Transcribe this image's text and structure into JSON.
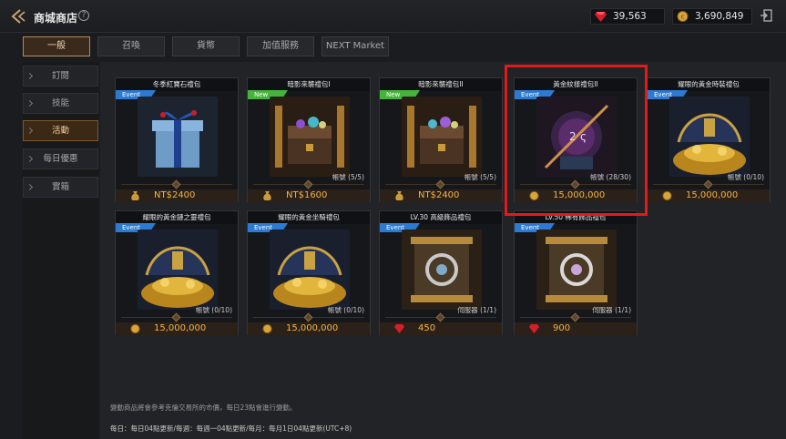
{
  "header": {
    "title": "商城商店",
    "help_glyph": "?",
    "gem_amount": "39,563",
    "coin_amount": "3,690,849"
  },
  "tabs": [
    "一般",
    "召喚",
    "貨幣",
    "加值服務",
    "NEXT Market"
  ],
  "sidebar": [
    "訂閱",
    "技能",
    "活動",
    "每日優惠",
    "實箱"
  ],
  "active_tab": "一般",
  "active_sidebar": "活動",
  "products": [
    {
      "title": "冬季紅寶石禮包",
      "badge": "Event",
      "limit": "",
      "price": "NT$2400",
      "currency_icon": "money-bag-icon",
      "art": "gift-box"
    },
    {
      "title": "暗影來襲禮包I",
      "badge": "New",
      "limit": "帳號 (5/5)",
      "price": "NT$1600",
      "currency_icon": "money-bag-icon",
      "art": "treasure-chest"
    },
    {
      "title": "暗影來襲禮包II",
      "badge": "New",
      "limit": "帳號 (5/5)",
      "price": "NT$2400",
      "currency_icon": "money-bag-icon",
      "art": "treasure-chest"
    },
    {
      "title": "黃金紋樣禮包II",
      "badge": "Event",
      "limit": "帳號 (28/30)",
      "price": "15,000,000",
      "currency_icon": "coin-icon",
      "art": "emblem-orb"
    },
    {
      "title": "耀眼的黃金時裝禮包",
      "badge": "Event",
      "limit": "帳號 (0/10)",
      "price": "15,000,000",
      "currency_icon": "coin-icon",
      "art": "gold-pile"
    },
    {
      "title": "耀眼的黃金鏈之靈禮包",
      "badge": "Event",
      "limit": "帳號 (0/10)",
      "price": "15,000,000",
      "currency_icon": "coin-icon",
      "art": "gold-pile"
    },
    {
      "title": "耀眼的黃金坐騎禮包",
      "badge": "Event",
      "limit": "帳號 (0/10)",
      "price": "15,000,000",
      "currency_icon": "coin-icon",
      "art": "gold-pile"
    },
    {
      "title": "LV.30 高級飾品禮包",
      "badge": "Event",
      "limit": "伺服器 (1/1)",
      "price": "450",
      "currency_icon": "ruby-icon",
      "art": "scroll-amulet"
    },
    {
      "title": "LV.50 稀有飾品禮包",
      "badge": "Event",
      "limit": "伺服器 (1/1)",
      "price": "900",
      "currency_icon": "ruby-icon",
      "art": "scroll-amulet"
    }
  ],
  "footer": {
    "note": "變動商品將會參考克倫交易所的市價，每日23點會進行變動。",
    "reset": "每日：每日04點更新/每週：每週一04點更新/每月：每月1日04點更新(UTC+8)"
  },
  "colors": {
    "accent": "#f2b447",
    "highlight": "#e21a1a",
    "event_badge": "#2c7ad1",
    "new_badge": "#46b43c"
  }
}
